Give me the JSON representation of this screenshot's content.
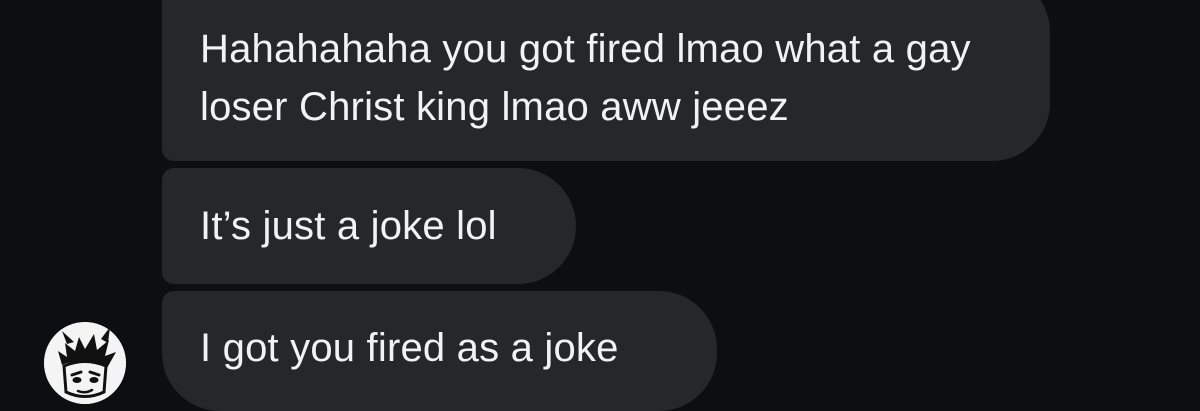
{
  "messages": [
    {
      "text": "Hahahahaha you got fired lmao what a gay loser Christ king lmao aww jeeez"
    },
    {
      "text": "It’s just a joke lol"
    },
    {
      "text": "I got you fired as a joke"
    }
  ],
  "colors": {
    "background": "#0d0e11",
    "bubble": "#26272b",
    "text": "#f2f2f4"
  },
  "icons": {
    "avatar": "cartoon-character-avatar-icon"
  }
}
